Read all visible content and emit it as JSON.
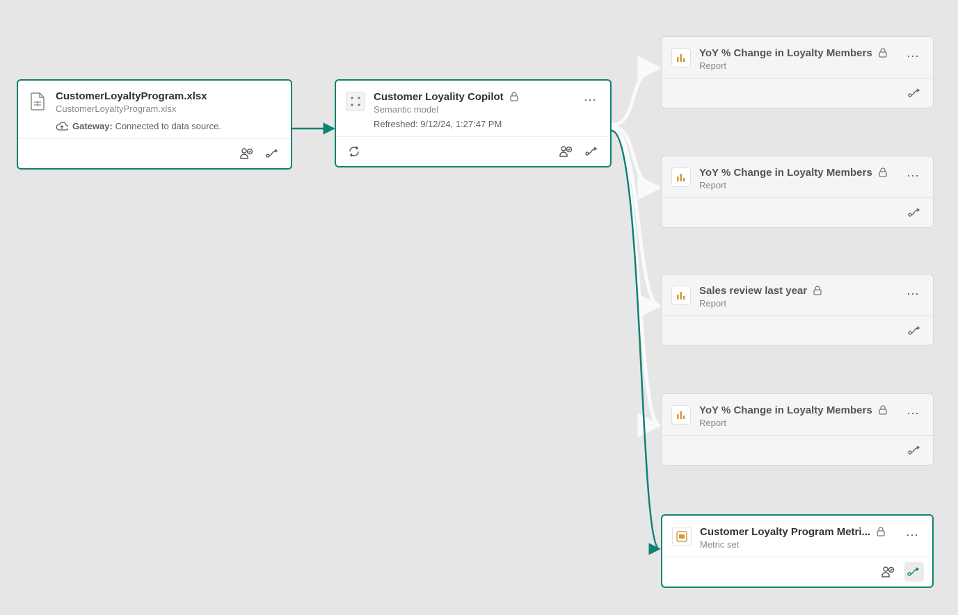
{
  "source": {
    "title": "CustomerLoyaltyProgram.xlsx",
    "subtitle": "CustomerLoyaltyProgram.xlsx",
    "gateway_label": "Gateway:",
    "gateway_status": "Connected to data source."
  },
  "model": {
    "title": "Customer Loyality Copilot",
    "subtitle": "Semantic model",
    "refreshed": "Refreshed: 9/12/24, 1:27:47 PM"
  },
  "downstream": [
    {
      "title": "YoY % Change in Loyalty Members",
      "subtitle": "Report",
      "icon": "report",
      "selected": false
    },
    {
      "title": "YoY % Change in Loyalty Members",
      "subtitle": "Report",
      "icon": "report",
      "selected": false
    },
    {
      "title": "Sales review last year",
      "subtitle": "Report",
      "icon": "report",
      "selected": false
    },
    {
      "title": "YoY % Change in Loyalty Members",
      "subtitle": "Report",
      "icon": "report",
      "selected": false
    },
    {
      "title": "Customer Loyalty Program Metri...",
      "subtitle": "Metric set",
      "icon": "metric",
      "selected": true
    }
  ],
  "colors": {
    "accent": "#108272"
  }
}
